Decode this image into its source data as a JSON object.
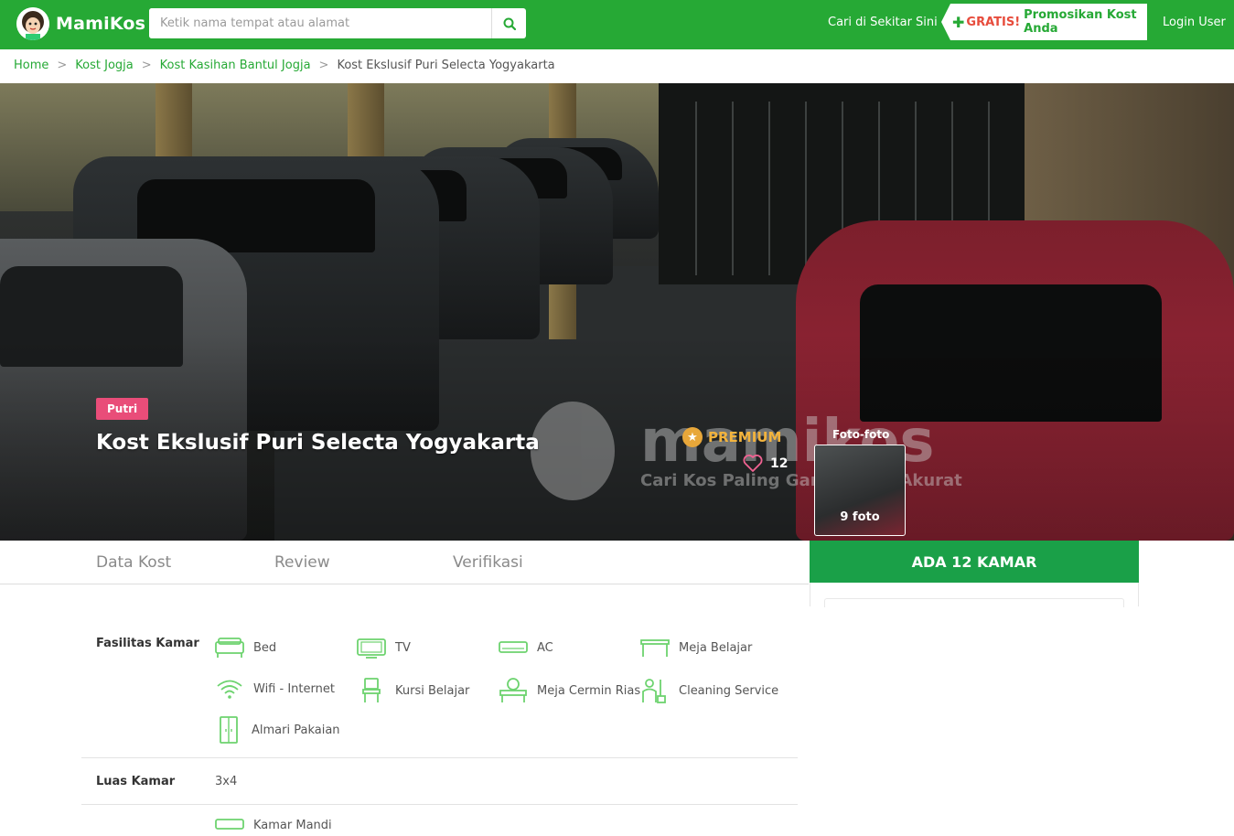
{
  "header": {
    "brand": "MamiKos",
    "search_placeholder": "Ketik nama tempat atau alamat",
    "nearby_label": "Cari di Sekitar Sini",
    "promo_free": "GRATIS!",
    "promo_rest": "Promosikan Kost Anda",
    "login_label": "Login User",
    "brand_color": "#26a935"
  },
  "breadcrumb": {
    "items": [
      "Home",
      "Kost Jogja",
      "Kost Kasihan Bantul Jogja"
    ],
    "separator": ">",
    "current": "Kost Ekslusif Puri Selecta Yogyakarta"
  },
  "hero": {
    "tag": "Putri",
    "title": "Kost Ekslusif Puri Selecta Yogyakarta",
    "premium_label": "PREMIUM",
    "like_count": "12",
    "photo_label": "Foto-foto",
    "photo_count": "9 foto",
    "watermark_title": "mamikos",
    "watermark_sub": "Cari Kos Paling Gampang & Akurat"
  },
  "tabs": [
    "Data Kost",
    "Review",
    "Verifikasi"
  ],
  "sidebar": {
    "rooms_label": "ADA 12 KAMAR"
  },
  "facilities": {
    "room_label": "Fasilitas Kamar",
    "room_items": [
      {
        "label": "Bed",
        "icon": "bed-icon"
      },
      {
        "label": "TV",
        "icon": "tv-icon"
      },
      {
        "label": "AC",
        "icon": "ac-icon"
      },
      {
        "label": "Meja Belajar",
        "icon": "desk-icon"
      },
      {
        "label": "Wifi - Internet",
        "icon": "wifi-icon"
      },
      {
        "label": "Kursi Belajar",
        "icon": "chair-icon"
      },
      {
        "label": "Meja Cermin Rias",
        "icon": "vanity-icon"
      },
      {
        "label": "Cleaning Service",
        "icon": "cleaning-icon"
      },
      {
        "label": "Almari Pakaian",
        "icon": "wardrobe-icon"
      }
    ],
    "size_label": "Luas Kamar",
    "size_value": "3x4",
    "next_row_first": "Kamar Mandi"
  }
}
